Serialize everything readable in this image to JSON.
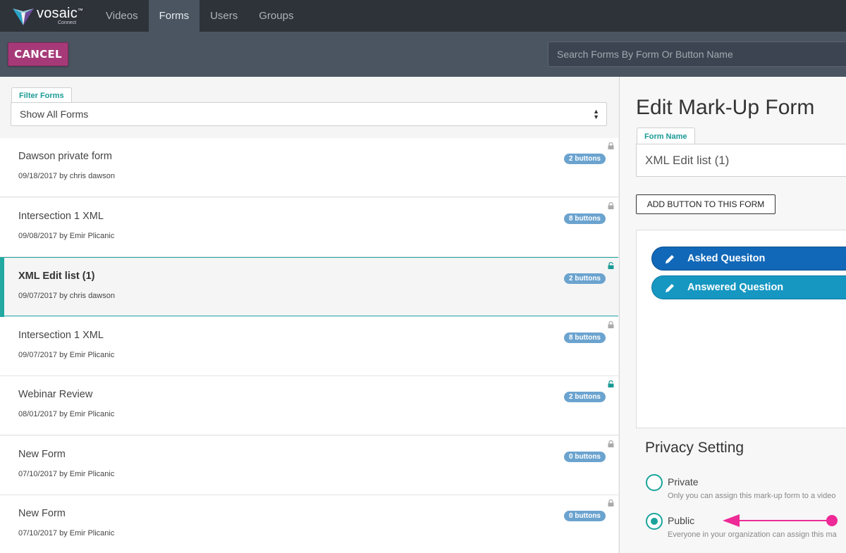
{
  "app": {
    "brand": "vosaic",
    "brand_mark": "™",
    "sub": "Connect"
  },
  "nav": {
    "items": [
      {
        "label": "Videos",
        "active": false
      },
      {
        "label": "Forms",
        "active": true
      },
      {
        "label": "Users",
        "active": false
      },
      {
        "label": "Groups",
        "active": false
      }
    ]
  },
  "toolbar": {
    "cancel_label": "CANCEL",
    "search_placeholder": "Search Forms By Form Or Button Name"
  },
  "filter": {
    "label": "Filter Forms",
    "selected": "Show All Forms"
  },
  "forms": [
    {
      "title": "Dawson private form",
      "meta": "09/18/2017 by chris dawson",
      "badge": "2 buttons",
      "lock": "locked"
    },
    {
      "title": "Intersection 1 XML",
      "meta": "09/08/2017 by Emir Plicanic",
      "badge": "8 buttons",
      "lock": "locked"
    },
    {
      "title": "XML Edit list (1)",
      "meta": "09/07/2017 by chris dawson",
      "badge": "2 buttons",
      "lock": "unlocked"
    },
    {
      "title": "Intersection 1 XML",
      "meta": "09/07/2017 by Emir Plicanic",
      "badge": "8 buttons",
      "lock": "locked"
    },
    {
      "title": "Webinar Review",
      "meta": "08/01/2017 by Emir Plicanic",
      "badge": "2 buttons",
      "lock": "unlocked"
    },
    {
      "title": "New Form",
      "meta": "07/10/2017 by Emir Plicanic",
      "badge": "0 buttons",
      "lock": "locked"
    },
    {
      "title": "New Form",
      "meta": "07/10/2017 by Emir Plicanic",
      "badge": "0 buttons",
      "lock": "locked"
    }
  ],
  "editor": {
    "title": "Edit Mark-Up Form",
    "form_name_label": "Form Name",
    "form_name_value": "XML Edit list (1)",
    "add_button_label": "ADD BUTTON TO THIS FORM",
    "markup_buttons": [
      {
        "label": "Asked Quesiton",
        "color": "#1168b8"
      },
      {
        "label": "Answered Question",
        "color": "#1597c2"
      }
    ],
    "privacy_title": "Privacy Setting",
    "privacy_options": [
      {
        "label": "Private",
        "desc": "Only you can assign this mark-up form to a video",
        "checked": false
      },
      {
        "label": "Public",
        "desc": "Everyone in your organization can assign this ma",
        "checked": true
      }
    ]
  },
  "colors": {
    "accent": "#21a9a2",
    "cancel": "#a63a78",
    "nav_bg": "#2e3239",
    "toolbar_bg": "#4a5561",
    "badge": "#6ba3cf",
    "arrow": "#ee2a96"
  }
}
